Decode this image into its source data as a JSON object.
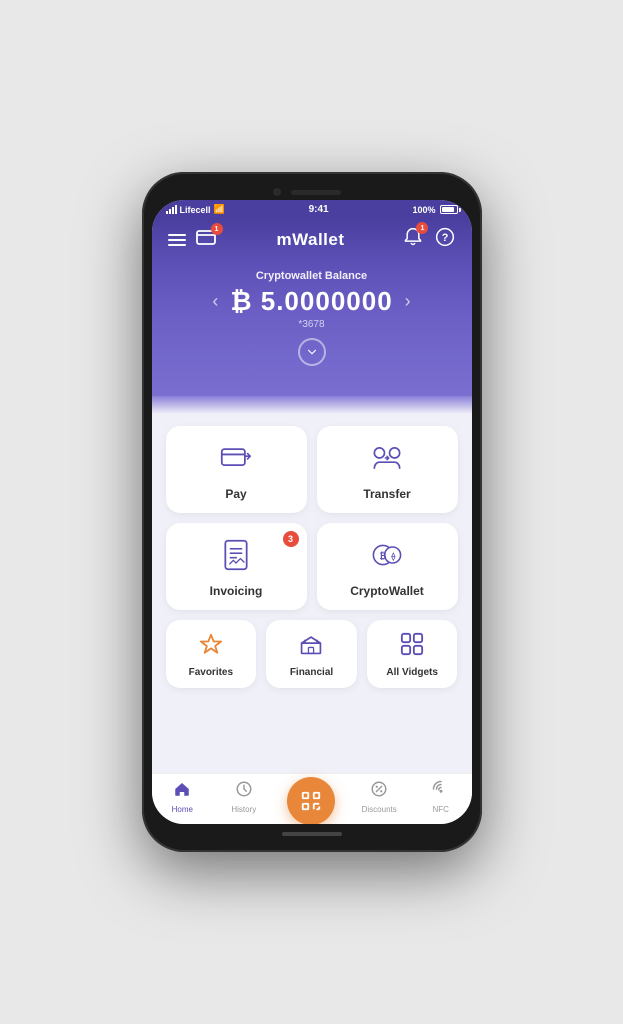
{
  "status_bar": {
    "carrier": "Lifecell",
    "wifi_icon": "wifi",
    "time": "9:41",
    "battery": "100%"
  },
  "header": {
    "title": "mWallet",
    "menu_label": "menu",
    "card_label": "card",
    "notification_label": "notifications",
    "notification_badge": "1",
    "help_label": "help"
  },
  "balance": {
    "label": "Cryptowallet Balance",
    "currency_symbol": "₿",
    "amount": "5.0000000",
    "account": "*3678",
    "prev_label": "‹",
    "next_label": "›",
    "expand_label": "⌄"
  },
  "actions": {
    "pay": {
      "label": "Pay",
      "badge": null
    },
    "transfer": {
      "label": "Transfer",
      "badge": null
    },
    "invoicing": {
      "label": "Invoicing",
      "badge": "3"
    },
    "cryptowallet": {
      "label": "CryptoWallet",
      "badge": null
    }
  },
  "extras": {
    "favorites": {
      "label": "Favorites"
    },
    "financial": {
      "label": "Financial"
    },
    "all_vidgets": {
      "label": "All Vidgets"
    }
  },
  "nav": {
    "home": {
      "label": "Home"
    },
    "history": {
      "label": "History"
    },
    "scan": {
      "label": "Scan"
    },
    "discounts": {
      "label": "Discounts"
    },
    "nfc": {
      "label": "NFC"
    }
  }
}
